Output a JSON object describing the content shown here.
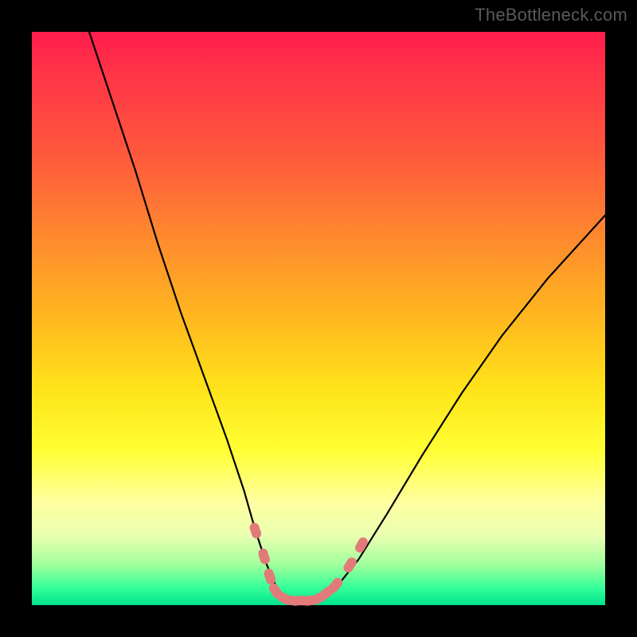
{
  "watermark": "TheBottleneck.com",
  "colors": {
    "page_bg": "#000000",
    "curve_stroke": "#000000",
    "marker_fill": "#e27a7a",
    "marker_stroke": "#d86a6a",
    "gradient_top": "#ff1d4c",
    "gradient_bottom": "#00e28e"
  },
  "chart_data": {
    "type": "line",
    "title": "",
    "xlabel": "",
    "ylabel": "",
    "xlim": [
      0,
      100
    ],
    "ylim": [
      0,
      100
    ],
    "grid": false,
    "note": "Axis numeric ticks are not displayed in the image; x/y are normalized 0–100. Curve represents a bottleneck metric where low y is optimal (green zone).",
    "series": [
      {
        "name": "bottleneck-curve",
        "x": [
          10,
          14,
          18,
          22,
          26,
          30,
          34,
          37,
          39,
          41,
          42.5,
          44,
          46,
          48,
          50,
          53,
          57,
          62,
          68,
          75,
          82,
          90,
          100
        ],
        "y": [
          100,
          88,
          76,
          63,
          51,
          40,
          29,
          20,
          13,
          7,
          3.5,
          1.2,
          0.5,
          0.5,
          1.0,
          3.0,
          8,
          16,
          26,
          37,
          47,
          57,
          68
        ]
      }
    ],
    "markers": {
      "name": "highlight-points",
      "note": "Salmon rounded markers near the curve minimum; plotted in screen-space (0–100).",
      "points": [
        {
          "x": 39.0,
          "y": 13.0
        },
        {
          "x": 40.5,
          "y": 8.5
        },
        {
          "x": 41.5,
          "y": 5.0
        },
        {
          "x": 42.5,
          "y": 2.5
        },
        {
          "x": 44.0,
          "y": 1.2
        },
        {
          "x": 45.5,
          "y": 0.8
        },
        {
          "x": 47.0,
          "y": 0.8
        },
        {
          "x": 48.5,
          "y": 0.8
        },
        {
          "x": 50.0,
          "y": 1.2
        },
        {
          "x": 51.5,
          "y": 2.2
        },
        {
          "x": 53.0,
          "y": 3.5
        },
        {
          "x": 55.5,
          "y": 7.0
        },
        {
          "x": 57.5,
          "y": 10.5
        }
      ]
    }
  }
}
